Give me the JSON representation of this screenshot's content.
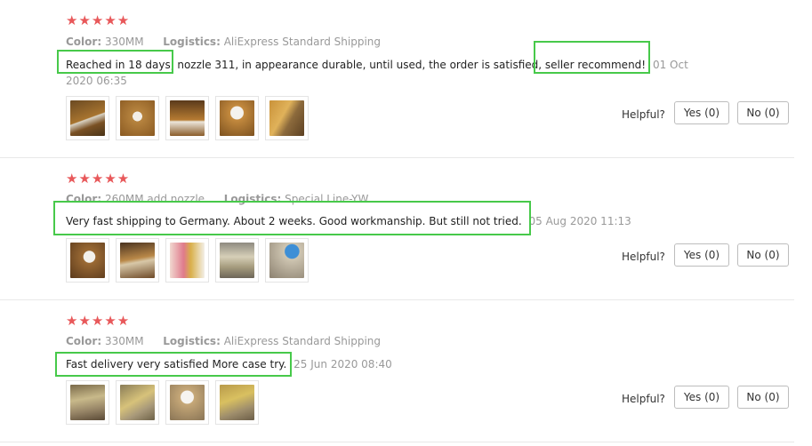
{
  "reviews": [
    {
      "rating": 5,
      "stars": "★★★★★",
      "color_label": "Color:",
      "color_value": "330MM",
      "logistics_label": "Logistics:",
      "logistics_value": "AliExpress Standard Shipping",
      "text": "Reached in 18 days, nozzle 311, in appearance durable, until used, the order is satisfied, seller recommend!",
      "date": "01 Oct 2020 06:35",
      "photo_count": 5,
      "helpful_label": "Helpful?",
      "yes_label": "Yes (0)",
      "no_label": "No (0)"
    },
    {
      "rating": 5,
      "stars": "★★★★★",
      "color_label": "Color:",
      "color_value": "260MM add nozzle",
      "logistics_label": "Logistics:",
      "logistics_value": "Special Line-YW",
      "text": "Very fast shipping to Germany. About 2 weeks. Good workmanship. But still not tried.",
      "date": "05 Aug 2020 11:13",
      "photo_count": 5,
      "helpful_label": "Helpful?",
      "yes_label": "Yes (0)",
      "no_label": "No (0)"
    },
    {
      "rating": 5,
      "stars": "★★★★★",
      "color_label": "Color:",
      "color_value": "330MM",
      "logistics_label": "Logistics:",
      "logistics_value": "AliExpress Standard Shipping",
      "text": "Fast delivery very satisfied More case try.",
      "date": "25 Jun 2020 08:40",
      "photo_count": 4,
      "helpful_label": "Helpful?",
      "yes_label": "Yes (0)",
      "no_label": "No (0)"
    }
  ],
  "colors": {
    "star": "#e8585a",
    "highlight": "#47c94a",
    "muted_text": "#999999",
    "border": "#bdbdbd"
  },
  "icons": {
    "star": "star-icon"
  }
}
